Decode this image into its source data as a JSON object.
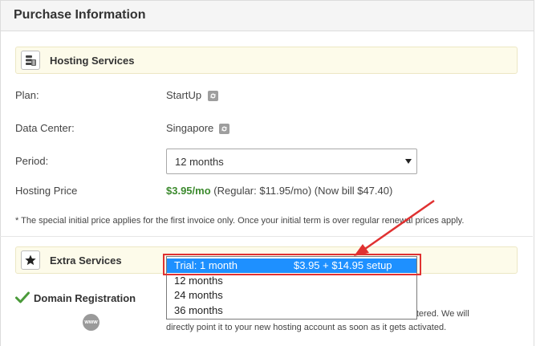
{
  "header": {
    "title": "Purchase Information"
  },
  "hosting": {
    "section_title": "Hosting Services",
    "section_icon": "server-stack-icon",
    "plan_label": "Plan:",
    "plan_value": "StartUp",
    "datacenter_label": "Data Center:",
    "datacenter_value": "Singapore",
    "period_label": "Period:",
    "period_value": "12 months",
    "price_label": "Hosting Price",
    "price_main": "$3.95/mo",
    "price_detail": "(Regular: $11.95/mo) (Now bill $47.40)",
    "note": "* The special initial price applies for the first invoice only. Once your initial term is over regular renewal prices apply."
  },
  "period_dropdown": {
    "options": [
      {
        "label": "Trial: 1 month",
        "price": "$3.95 + $14.95 setup"
      },
      {
        "label": "12 months",
        "price": ""
      },
      {
        "label": "24 months",
        "price": ""
      },
      {
        "label": "36 months",
        "price": ""
      }
    ],
    "highlighted_index": 0
  },
  "extras": {
    "section_title": "Extra Services",
    "section_icon": "star-icon",
    "domain_title": "Domain Registration",
    "domain_icon_label": "www",
    "domain_desc_line1": "registered. We will",
    "domain_desc_line2": "directly point it to your new hosting account as soon as it gets activated."
  },
  "colors": {
    "accent_green": "#3c8a2e",
    "highlight_blue": "#1e90ff",
    "annotation_red": "#e03131",
    "section_bg": "#fdfbea"
  }
}
